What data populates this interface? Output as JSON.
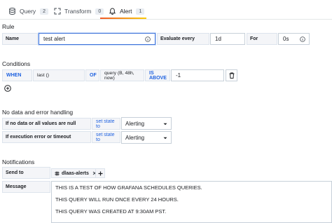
{
  "tabs": [
    {
      "label": "Query",
      "count": "2",
      "icon": "database-icon"
    },
    {
      "label": "Transform",
      "count": "0",
      "icon": "transform-icon"
    },
    {
      "label": "Alert",
      "count": "1",
      "icon": "bell-icon"
    }
  ],
  "rule": {
    "section_title": "Rule",
    "name_label": "Name",
    "name_value": "test alert",
    "evaluate_label": "Evaluate every",
    "evaluate_value": "1d",
    "for_label": "For",
    "for_value": "0s"
  },
  "conditions": {
    "section_title": "Conditions",
    "when": "WHEN",
    "reducer": "last ()",
    "of": "OF",
    "query": "query (B, 48h, now)",
    "evaluator": "IS ABOVE",
    "threshold": "-1"
  },
  "no_data": {
    "section_title": "No data and error handling",
    "no_data_label": "If no data or all values are null",
    "no_data_set_state": "set state to",
    "no_data_value": "Alerting",
    "error_label": "If execution error or timeout",
    "error_set_state": "set state to",
    "error_value": "Alerting"
  },
  "notifications": {
    "section_title": "Notifications",
    "send_to_label": "Send to",
    "channel": "dlaas-alerts",
    "message_label": "Message",
    "message_lines": [
      "THIS IS A TEST OF HOW GRAFANA SCHEDULES QUERIES.",
      "THIS QUERY WILL RUN ONCE EVERY 24 HOURS.",
      "THIS QUERY WAS CREATED AT 9:30AM PST."
    ]
  },
  "colors": {
    "accent": "#1f62e0",
    "tab_underline": "#f05a28"
  }
}
